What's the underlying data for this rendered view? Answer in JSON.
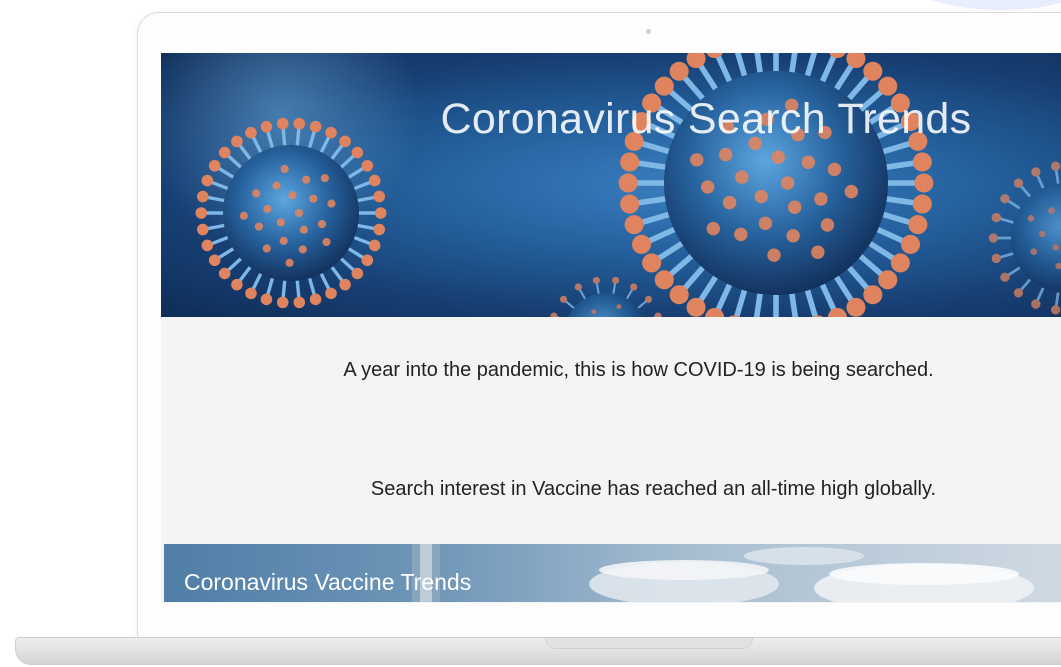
{
  "hero": {
    "title": "Coronavirus Search Trends",
    "image_icon": "coronavirus-virion-illustration"
  },
  "main": {
    "intro_text": "A year into the pandemic, this is how COVID-19 is being searched.",
    "highlight_text": "Search interest in Vaccine has reached an all-time high globally."
  },
  "vaccine_card": {
    "title": "Coronavirus Vaccine Trends",
    "image_icon": "vaccine-vials-photo"
  },
  "colors": {
    "hero_blue": "#1f5a96",
    "virus_spike": "#e0845f",
    "page_background": "#f4f4f4",
    "body_text": "#222222"
  }
}
